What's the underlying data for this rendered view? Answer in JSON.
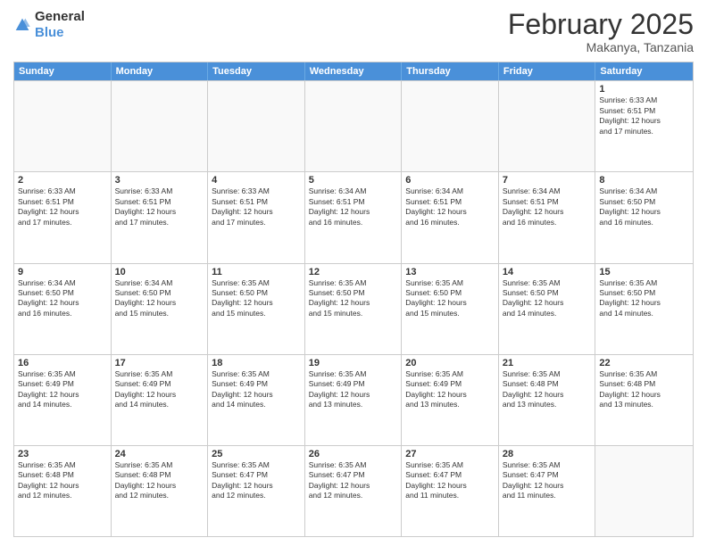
{
  "header": {
    "logo_general": "General",
    "logo_blue": "Blue",
    "month_title": "February 2025",
    "location": "Makanya, Tanzania"
  },
  "days_of_week": [
    "Sunday",
    "Monday",
    "Tuesday",
    "Wednesday",
    "Thursday",
    "Friday",
    "Saturday"
  ],
  "weeks": [
    [
      {
        "day": "",
        "info": ""
      },
      {
        "day": "",
        "info": ""
      },
      {
        "day": "",
        "info": ""
      },
      {
        "day": "",
        "info": ""
      },
      {
        "day": "",
        "info": ""
      },
      {
        "day": "",
        "info": ""
      },
      {
        "day": "1",
        "info": "Sunrise: 6:33 AM\nSunset: 6:51 PM\nDaylight: 12 hours\nand 17 minutes."
      }
    ],
    [
      {
        "day": "2",
        "info": "Sunrise: 6:33 AM\nSunset: 6:51 PM\nDaylight: 12 hours\nand 17 minutes."
      },
      {
        "day": "3",
        "info": "Sunrise: 6:33 AM\nSunset: 6:51 PM\nDaylight: 12 hours\nand 17 minutes."
      },
      {
        "day": "4",
        "info": "Sunrise: 6:33 AM\nSunset: 6:51 PM\nDaylight: 12 hours\nand 17 minutes."
      },
      {
        "day": "5",
        "info": "Sunrise: 6:34 AM\nSunset: 6:51 PM\nDaylight: 12 hours\nand 16 minutes."
      },
      {
        "day": "6",
        "info": "Sunrise: 6:34 AM\nSunset: 6:51 PM\nDaylight: 12 hours\nand 16 minutes."
      },
      {
        "day": "7",
        "info": "Sunrise: 6:34 AM\nSunset: 6:51 PM\nDaylight: 12 hours\nand 16 minutes."
      },
      {
        "day": "8",
        "info": "Sunrise: 6:34 AM\nSunset: 6:50 PM\nDaylight: 12 hours\nand 16 minutes."
      }
    ],
    [
      {
        "day": "9",
        "info": "Sunrise: 6:34 AM\nSunset: 6:50 PM\nDaylight: 12 hours\nand 16 minutes."
      },
      {
        "day": "10",
        "info": "Sunrise: 6:34 AM\nSunset: 6:50 PM\nDaylight: 12 hours\nand 15 minutes."
      },
      {
        "day": "11",
        "info": "Sunrise: 6:35 AM\nSunset: 6:50 PM\nDaylight: 12 hours\nand 15 minutes."
      },
      {
        "day": "12",
        "info": "Sunrise: 6:35 AM\nSunset: 6:50 PM\nDaylight: 12 hours\nand 15 minutes."
      },
      {
        "day": "13",
        "info": "Sunrise: 6:35 AM\nSunset: 6:50 PM\nDaylight: 12 hours\nand 15 minutes."
      },
      {
        "day": "14",
        "info": "Sunrise: 6:35 AM\nSunset: 6:50 PM\nDaylight: 12 hours\nand 14 minutes."
      },
      {
        "day": "15",
        "info": "Sunrise: 6:35 AM\nSunset: 6:50 PM\nDaylight: 12 hours\nand 14 minutes."
      }
    ],
    [
      {
        "day": "16",
        "info": "Sunrise: 6:35 AM\nSunset: 6:49 PM\nDaylight: 12 hours\nand 14 minutes."
      },
      {
        "day": "17",
        "info": "Sunrise: 6:35 AM\nSunset: 6:49 PM\nDaylight: 12 hours\nand 14 minutes."
      },
      {
        "day": "18",
        "info": "Sunrise: 6:35 AM\nSunset: 6:49 PM\nDaylight: 12 hours\nand 14 minutes."
      },
      {
        "day": "19",
        "info": "Sunrise: 6:35 AM\nSunset: 6:49 PM\nDaylight: 12 hours\nand 13 minutes."
      },
      {
        "day": "20",
        "info": "Sunrise: 6:35 AM\nSunset: 6:49 PM\nDaylight: 12 hours\nand 13 minutes."
      },
      {
        "day": "21",
        "info": "Sunrise: 6:35 AM\nSunset: 6:48 PM\nDaylight: 12 hours\nand 13 minutes."
      },
      {
        "day": "22",
        "info": "Sunrise: 6:35 AM\nSunset: 6:48 PM\nDaylight: 12 hours\nand 13 minutes."
      }
    ],
    [
      {
        "day": "23",
        "info": "Sunrise: 6:35 AM\nSunset: 6:48 PM\nDaylight: 12 hours\nand 12 minutes."
      },
      {
        "day": "24",
        "info": "Sunrise: 6:35 AM\nSunset: 6:48 PM\nDaylight: 12 hours\nand 12 minutes."
      },
      {
        "day": "25",
        "info": "Sunrise: 6:35 AM\nSunset: 6:47 PM\nDaylight: 12 hours\nand 12 minutes."
      },
      {
        "day": "26",
        "info": "Sunrise: 6:35 AM\nSunset: 6:47 PM\nDaylight: 12 hours\nand 12 minutes."
      },
      {
        "day": "27",
        "info": "Sunrise: 6:35 AM\nSunset: 6:47 PM\nDaylight: 12 hours\nand 11 minutes."
      },
      {
        "day": "28",
        "info": "Sunrise: 6:35 AM\nSunset: 6:47 PM\nDaylight: 12 hours\nand 11 minutes."
      },
      {
        "day": "",
        "info": ""
      }
    ]
  ]
}
